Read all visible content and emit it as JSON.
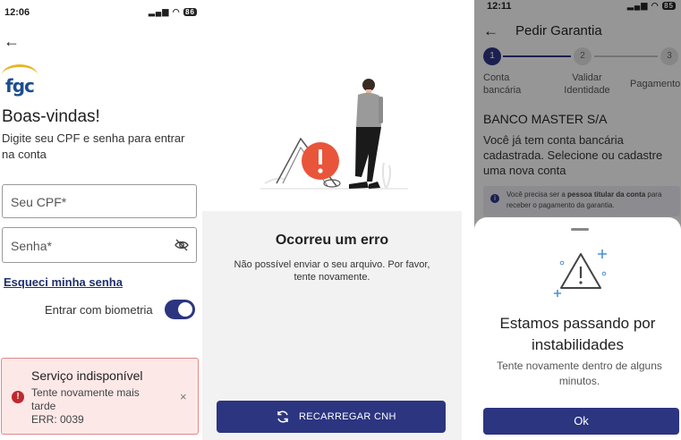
{
  "login": {
    "status_time": "12:06",
    "battery": "86",
    "logo_text": "fgc",
    "heading": "Boas-vindas!",
    "subtitle": "Digite seu CPF e senha para entrar na conta",
    "cpf_label": "Seu CPF*",
    "password_label": "Senha*",
    "forgot_link": "Esqueci minha senha",
    "biometrics_label": "Entrar com biometria",
    "biometrics_enabled": true,
    "alert": {
      "title": "Serviço indisponível",
      "message": "Tente novamente mais tarde",
      "code": "ERR: 0039",
      "icon": "!",
      "close": "×"
    }
  },
  "upload_error": {
    "title": "Ocorreu um erro",
    "message": "Não possível enviar o seu arquivo. Por favor, tente novamente.",
    "button": "RECARREGAR CNH"
  },
  "guarantee": {
    "status_time": "12:11",
    "battery": "85",
    "title": "Pedir Garantia",
    "steps": [
      {
        "number": "1",
        "label": "Conta bancária"
      },
      {
        "number": "2",
        "label": "Validar Identidade"
      },
      {
        "number": "3",
        "label": "Pagamento"
      }
    ],
    "bank_name": "BANCO MASTER S/A",
    "bank_message": "Você já tem conta bancária cadastrada. Selecione ou cadastre uma nova conta",
    "info_prefix": "Você precisa ser a ",
    "info_bold": "pessoa titular da conta",
    "info_suffix": " para receber o pagamento da garantia.",
    "sheet": {
      "title": "Estamos passando por instabilidades",
      "message": "Tente novamente dentro de alguns minutos.",
      "button": "Ok"
    }
  },
  "colors": {
    "primary": "#2c3580",
    "alert_bg": "#fde8e8",
    "alert_border": "#e38787",
    "error_red": "#c0282d",
    "illustration_red": "#e9553a"
  }
}
